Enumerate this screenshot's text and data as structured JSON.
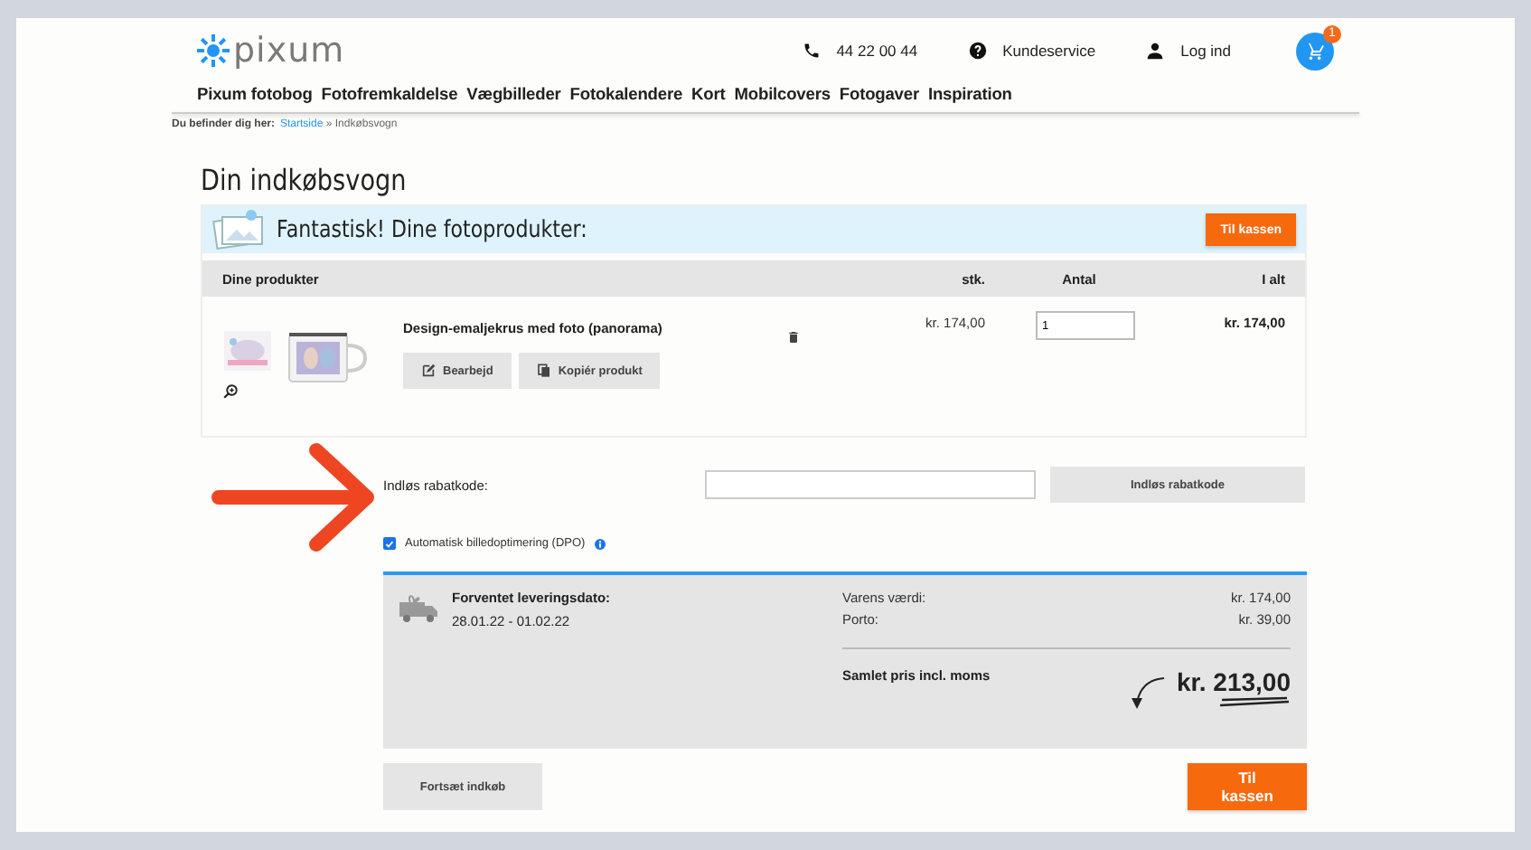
{
  "header": {
    "logo": "pixum",
    "phone": "44 22 00 44",
    "service": "Kundeservice",
    "login": "Log ind",
    "cart_count": "1"
  },
  "nav": [
    "Pixum fotobog",
    "Fotofremkaldelse",
    "Vægbilleder",
    "Fotokalendere",
    "Kort",
    "Mobilcovers",
    "Fotogaver",
    "Inspiration"
  ],
  "breadcrumb": {
    "label": "Du befinder dig her:",
    "link": "Startside",
    "separator": "»",
    "current": "Indkøbsvogn"
  },
  "title": "Din indkøbsvogn",
  "banner": {
    "text": "Fantastisk! Dine fotoprodukter:",
    "button": "Til kassen"
  },
  "table": {
    "columns": [
      "Dine produkter",
      "stk.",
      "Antal",
      "I alt"
    ],
    "rows": [
      {
        "name": "Design-emaljekrus med foto (panorama)",
        "unit_price": "kr. 174,00",
        "quantity": "1",
        "total": "kr. 174,00",
        "actions": [
          "Bearbejd",
          "Kopiér produkt"
        ]
      }
    ]
  },
  "discount": {
    "label": "Indløs rabatkode:",
    "button": "Indløs rabatkode"
  },
  "dpo": {
    "label": "Automatisk billedoptimering (DPO)",
    "checked": true
  },
  "summary": {
    "delivery_label": "Forventet leveringsdato:",
    "delivery_dates": "28.01.22 - 01.02.22",
    "lines": [
      {
        "label": "Varens værdi:",
        "value": "kr. 174,00"
      },
      {
        "label": "Porto:",
        "value": "kr. 39,00"
      }
    ],
    "total_label": "Samlet pris incl. moms",
    "total": "kr. 213,00"
  },
  "buttons": {
    "continue": "Fortsæt indkøb",
    "checkout": "Til kassen"
  }
}
